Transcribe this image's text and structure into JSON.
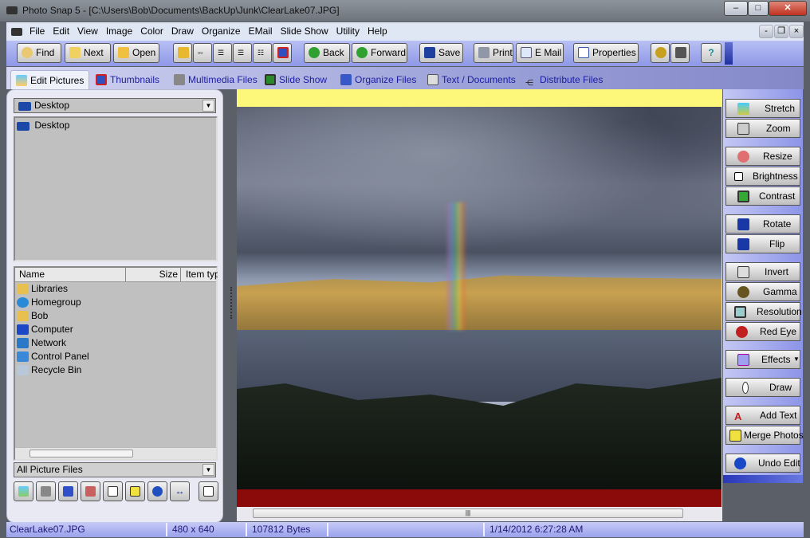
{
  "window": {
    "title": "Photo Snap 5 - [C:\\Users\\Bob\\Documents\\BackUp\\Junk\\ClearLake07.JPG]"
  },
  "menu": [
    "File",
    "Edit",
    "View",
    "Image",
    "Color",
    "Draw",
    "Organize",
    "EMail",
    "Slide Show",
    "Utility",
    "Help"
  ],
  "toolbar": {
    "find": "Find",
    "next": "Next",
    "open": "Open",
    "back": "Back",
    "forward": "Forward",
    "save": "Save",
    "print": "Print",
    "email": "E Mail",
    "properties": "Properties",
    "help": "?"
  },
  "tabs": [
    "Edit Pictures",
    "Thumbnails",
    "Multimedia Files",
    "Slide Show",
    "Organize Files",
    "Text / Documents",
    "Distribute Files"
  ],
  "left": {
    "location": "Desktop",
    "tree": [
      "Desktop"
    ],
    "columns": [
      "Name",
      "Size",
      "Item typ"
    ],
    "items": [
      "Libraries",
      "Homegroup",
      "Bob",
      "Computer",
      "Network",
      "Control Panel",
      "Recycle Bin"
    ],
    "filter": "All Picture Files"
  },
  "tools": [
    "Stretch",
    "Zoom",
    "Resize",
    "Brightness",
    "Contrast",
    "Rotate",
    "Flip",
    "Invert",
    "Gamma",
    "Resolution",
    "Red Eye",
    "Effects",
    "Draw",
    "Add Text",
    "Merge Photos",
    "Undo Edit"
  ],
  "status": {
    "file": "ClearLake07.JPG",
    "dimensions": "480 x 640",
    "size": "107812 Bytes",
    "blank": "",
    "date": "1/14/2012 6:27:28 AM"
  },
  "colors": {
    "top_strip": "#fdf77a",
    "bottom_strip": "#8b0a0a"
  }
}
